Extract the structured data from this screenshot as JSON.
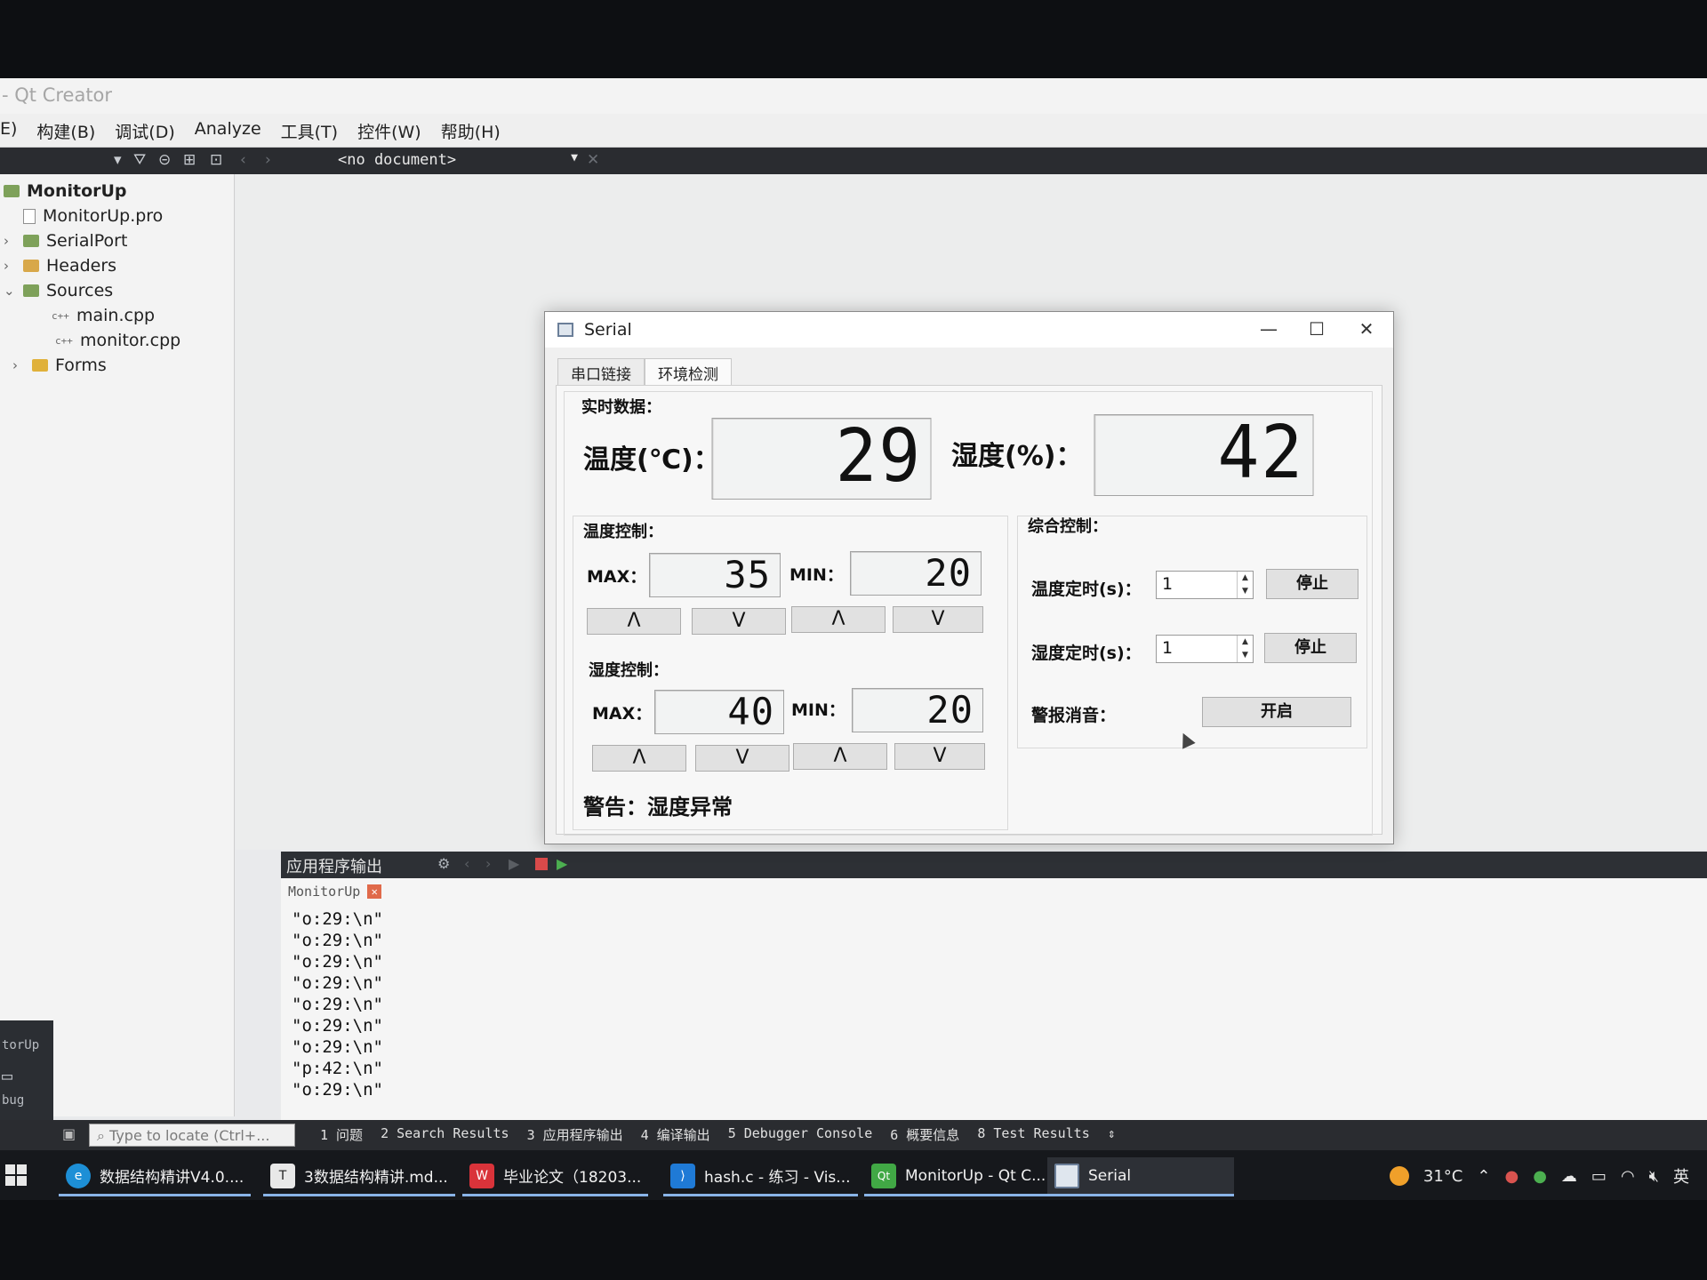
{
  "qt": {
    "title": "- Qt Creator",
    "menu": [
      "E)",
      "构建(B)",
      "调试(D)",
      "Analyze",
      "工具(T)",
      "控件(W)",
      "帮助(H)"
    ],
    "document_select": "<no document>"
  },
  "project_tree": {
    "root": "MonitorUp",
    "pro_file": "MonitorUp.pro",
    "serialport": "SerialPort",
    "headers": "Headers",
    "sources": "Sources",
    "main_cpp": "main.cpp",
    "monitor_cpp": "monitor.cpp",
    "forms": "Forms"
  },
  "left_strip": {
    "label1": "torUp",
    "label2": "bug"
  },
  "output": {
    "title": "应用程序输出",
    "tab": "MonitorUp",
    "lines": [
      "\"o:29:\\n\"",
      "\"o:29:\\n\"",
      "\"o:29:\\n\"",
      "\"o:29:\\n\"",
      "\"o:29:\\n\"",
      "\"o:29:\\n\"",
      "\"o:29:\\n\"",
      "\"p:42:\\n\"",
      "\"o:29:\\n\""
    ]
  },
  "status": {
    "locate_placeholder": "Type to locate (Ctrl+...",
    "pane_tabs": [
      "1 问题",
      "2 Search Results",
      "3 应用程序输出",
      "4 编译输出",
      "5 Debugger Console",
      "6 概要信息",
      "8 Test Results"
    ]
  },
  "taskbar": {
    "items": [
      "数据结构精讲V4.0....",
      "3数据结构精讲.md...",
      "毕业论文（18203...",
      "hash.c - 练习 - Vis...",
      "MonitorUp - Qt C...",
      "Serial"
    ],
    "temperature": "31°C",
    "ime": "英"
  },
  "serial": {
    "title": "Serial",
    "tabs": [
      "串口链接",
      "环境检测"
    ],
    "realtime_label": "实时数据：",
    "temp_label": "温度(℃)：",
    "temp_value": "29",
    "humi_label": "湿度(%)：",
    "humi_value": "42",
    "temp_ctrl": {
      "label": "温度控制：",
      "max_label": "MAX：",
      "max_value": "35",
      "min_label": "MIN：",
      "min_value": "20"
    },
    "humi_ctrl": {
      "label": "湿度控制：",
      "max_label": "MAX：",
      "max_value": "40",
      "min_label": "MIN：",
      "min_value": "20"
    },
    "up": "Λ",
    "down": "V",
    "combined": {
      "label": "综合控制：",
      "temp_timer_label": "温度定时(s)：",
      "temp_timer_value": "1",
      "temp_stop": "停止",
      "humi_timer_label": "湿度定时(s)：",
      "humi_timer_value": "1",
      "humi_stop": "停止",
      "alarm_label": "警报消音：",
      "alarm_button": "开启"
    },
    "warning": "警告：湿度异常"
  }
}
